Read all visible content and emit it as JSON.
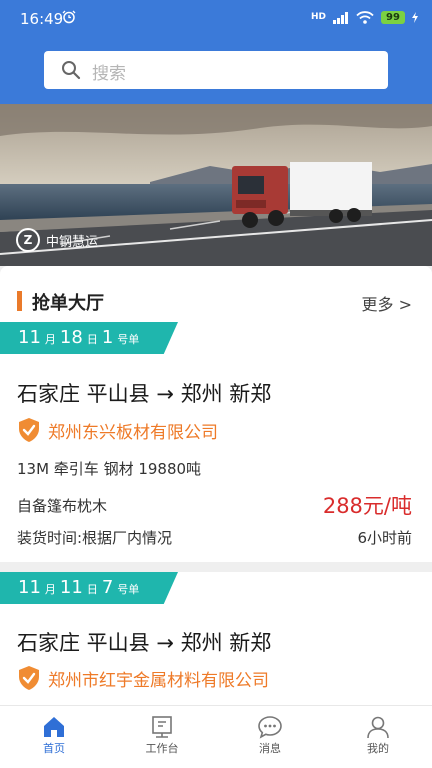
{
  "status_bar": {
    "time": "16:49",
    "network": "HD",
    "battery": "99"
  },
  "search": {
    "placeholder": "搜索"
  },
  "banner": {
    "brand": "中钢慧运"
  },
  "hall": {
    "title": "抢单大厅",
    "more": "更多 >"
  },
  "orders": [
    {
      "month": "11",
      "month_unit": "月",
      "day": "18",
      "day_unit": "日",
      "num": "1",
      "num_unit": "号单",
      "route": "石家庄 平山县 → 郑州 新郑",
      "company": "郑州东兴板材有限公司",
      "spec": "13M 牵引车 钢材 19880吨",
      "note": "自备篷布枕木",
      "price": "288元/吨",
      "loading": "装货时间:根据厂内情况",
      "posted": "6小时前"
    },
    {
      "month": "11",
      "month_unit": "月",
      "day": "11",
      "day_unit": "日",
      "num": "7",
      "num_unit": "号单",
      "route": "石家庄 平山县 → 郑州 新郑",
      "company": "郑州市红宇金属材料有限公司"
    }
  ],
  "tabs": [
    {
      "label": "首页",
      "icon": "home-icon",
      "active": true
    },
    {
      "label": "工作台",
      "icon": "workbench-icon",
      "active": false
    },
    {
      "label": "消息",
      "icon": "message-icon",
      "active": false
    },
    {
      "label": "我的",
      "icon": "profile-icon",
      "active": false
    }
  ],
  "colors": {
    "primary": "#3b7ad9",
    "accent": "#ee7a28",
    "ribbon": "#1fb6ad",
    "price": "#d92c2c"
  }
}
